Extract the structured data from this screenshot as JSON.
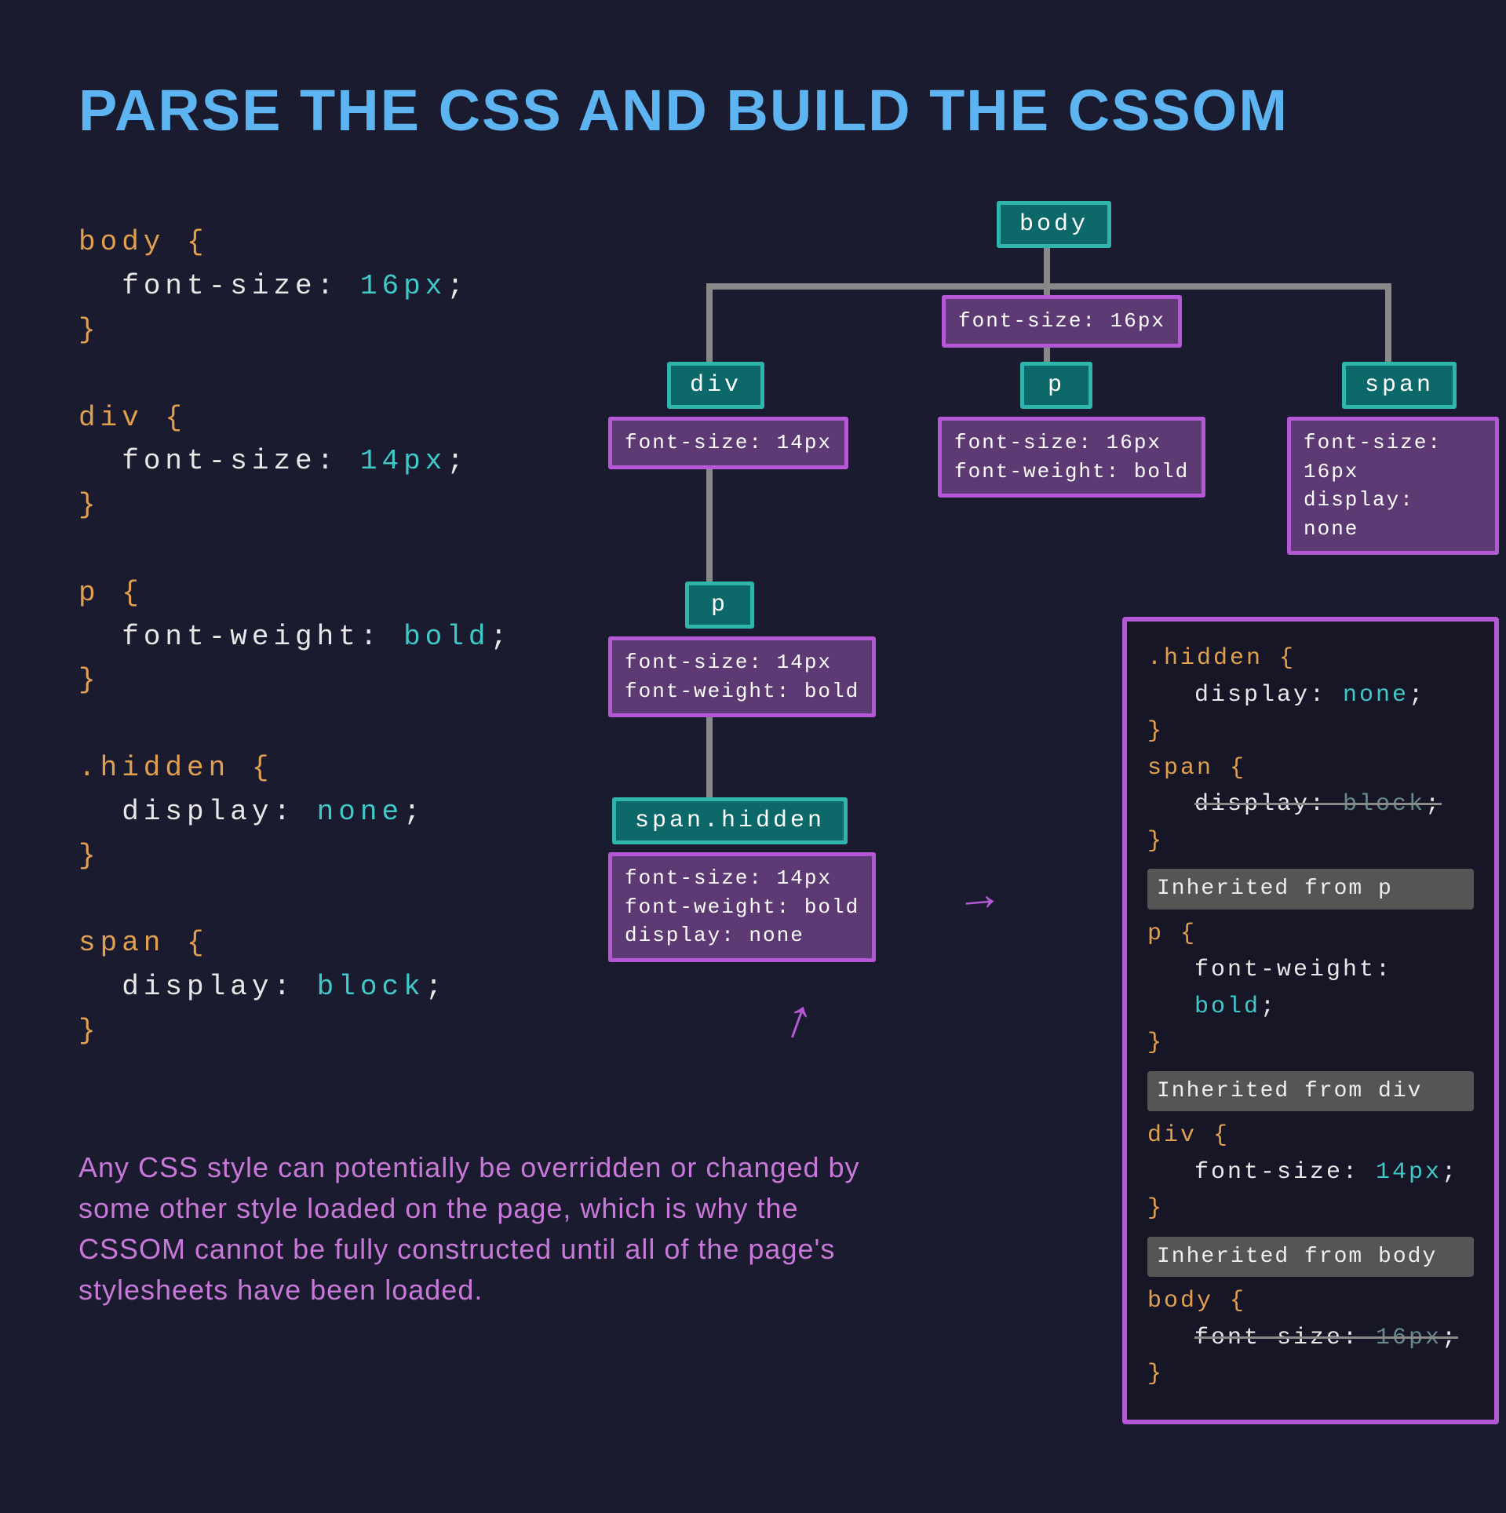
{
  "title": "PARSE THE CSS AND BUILD THE CSSOM",
  "explanation": "Any CSS style can potentially be overridden or changed by some other style loaded on the page, which is why the CSSOM cannot be fully constructed until all of the page's stylesheets have been loaded.",
  "css_rules": [
    {
      "selector": "body",
      "declarations": [
        {
          "property": "font-size",
          "value": "16px"
        }
      ]
    },
    {
      "selector": "div",
      "declarations": [
        {
          "property": "font-size",
          "value": "14px"
        }
      ]
    },
    {
      "selector": "p",
      "declarations": [
        {
          "property": "font-weight",
          "value": "bold"
        }
      ]
    },
    {
      "selector": ".hidden",
      "declarations": [
        {
          "property": "display",
          "value": "none"
        }
      ]
    },
    {
      "selector": "span",
      "declarations": [
        {
          "property": "display",
          "value": "block"
        }
      ]
    }
  ],
  "cssom_tree": {
    "body": {
      "tag": "body",
      "styles": [
        "font-size: 16px"
      ],
      "children": {
        "div": {
          "tag": "div",
          "styles": [
            "font-size: 14px"
          ],
          "children": {
            "p": {
              "tag": "p",
              "styles": [
                "font-size: 14px",
                "font-weight: bold"
              ],
              "children": {
                "span_hidden": {
                  "tag": "span.hidden",
                  "styles": [
                    "font-size: 14px",
                    "font-weight: bold",
                    "display: none"
                  ]
                }
              }
            }
          }
        },
        "p": {
          "tag": "p",
          "styles": [
            "font-size: 16px",
            "font-weight: bold"
          ]
        },
        "span": {
          "tag": "span",
          "styles": [
            "font-size: 16px",
            "display: none"
          ]
        }
      }
    }
  },
  "devtools": {
    "rules": [
      {
        "selector": ".hidden",
        "declarations": [
          {
            "property": "display",
            "value": "none",
            "struck": false
          }
        ]
      },
      {
        "selector": "span",
        "declarations": [
          {
            "property": "display",
            "value": "block",
            "struck": true
          }
        ]
      }
    ],
    "inherited": [
      {
        "from": "p",
        "selector": "p",
        "declarations": [
          {
            "property": "font-weight",
            "value": "bold",
            "struck": false
          }
        ]
      },
      {
        "from": "div",
        "selector": "div",
        "declarations": [
          {
            "property": "font-size",
            "value": "14px",
            "struck": false
          }
        ]
      },
      {
        "from": "body",
        "selector": "body",
        "declarations": [
          {
            "property": "font-size",
            "value": "16px",
            "struck": true
          }
        ]
      }
    ],
    "inherited_label_prefix": "Inherited from "
  }
}
